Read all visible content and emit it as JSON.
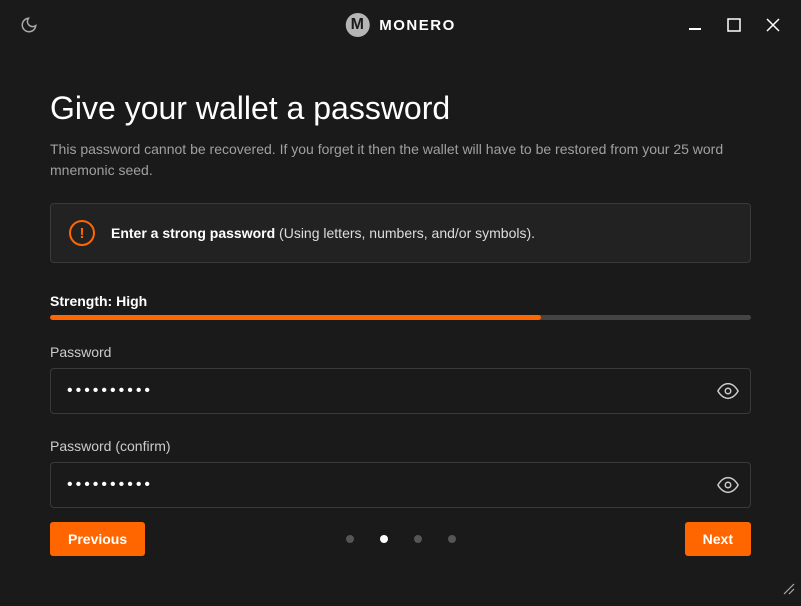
{
  "app": {
    "name": "MONERO",
    "logo_letter": "M"
  },
  "page": {
    "title": "Give your wallet a password",
    "subtitle": "This password cannot be recovered. If you forget it then the wallet will have to be restored from your 25 word mnemonic seed.",
    "infobox_strong": "Enter a strong password",
    "infobox_rest": " (Using letters, numbers, and/or symbols)."
  },
  "strength": {
    "label": "Strength: High",
    "percent": 70
  },
  "fields": {
    "password_label": "Password",
    "password_value": "••••••••••",
    "confirm_label": "Password (confirm)",
    "confirm_value": "••••••••••"
  },
  "nav": {
    "prev": "Previous",
    "next": "Next",
    "step_count": 4,
    "active_step": 2
  }
}
